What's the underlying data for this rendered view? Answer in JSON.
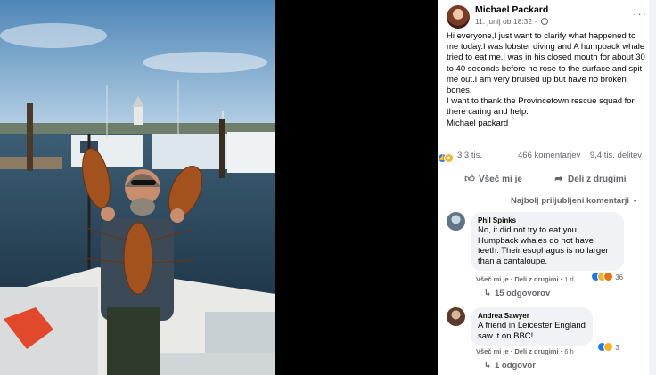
{
  "post": {
    "author": "Michael Packard",
    "date": "11. junij ob 18:32",
    "visibility_dot": "·",
    "more": "···",
    "text_lines": [
      "Hi everyone,I just want to clarify what happened to me today.I was lobster diving and A humpback whale tried to eat me.I was in his closed mouth for about 30 to 40 seconds before he rose to the surface and spit me out.I am very bruised up but have no broken bones.",
      "I want to thank the Provincetown rescue squad for there caring and help.",
      "Michael packard"
    ]
  },
  "stats": {
    "reactions": "3,3 tis.",
    "comments": "466 komentarjev",
    "shares": "9,4 tis. delitev"
  },
  "actions": {
    "like": "Všeč mi je",
    "share": "Deli z drugimi"
  },
  "sort": {
    "label": "Najbolj priljubljeni komentarji"
  },
  "comments": [
    {
      "name": "Phil Spinks",
      "text": "No, it did not try to eat you. Humpback whales do not have teeth. Their esophagus is no larger than a cantaloupe.",
      "like": "Všeč mi je",
      "share": "Deli z drugimi",
      "time": "1 d",
      "reactions": "36",
      "replies": "15 odgovorov"
    },
    {
      "name": "Andrea Sawyer",
      "text": "A friend in Leicester England saw it on BBC!",
      "like": "Všeč mi je",
      "share": "Deli z drugimi",
      "time": "6 h",
      "reactions": "3",
      "replies": "1 odgovor"
    }
  ],
  "colors": {
    "link_blue": "#1877f2",
    "secondary_text": "#65676b",
    "bubble_bg": "#f0f2f5"
  }
}
